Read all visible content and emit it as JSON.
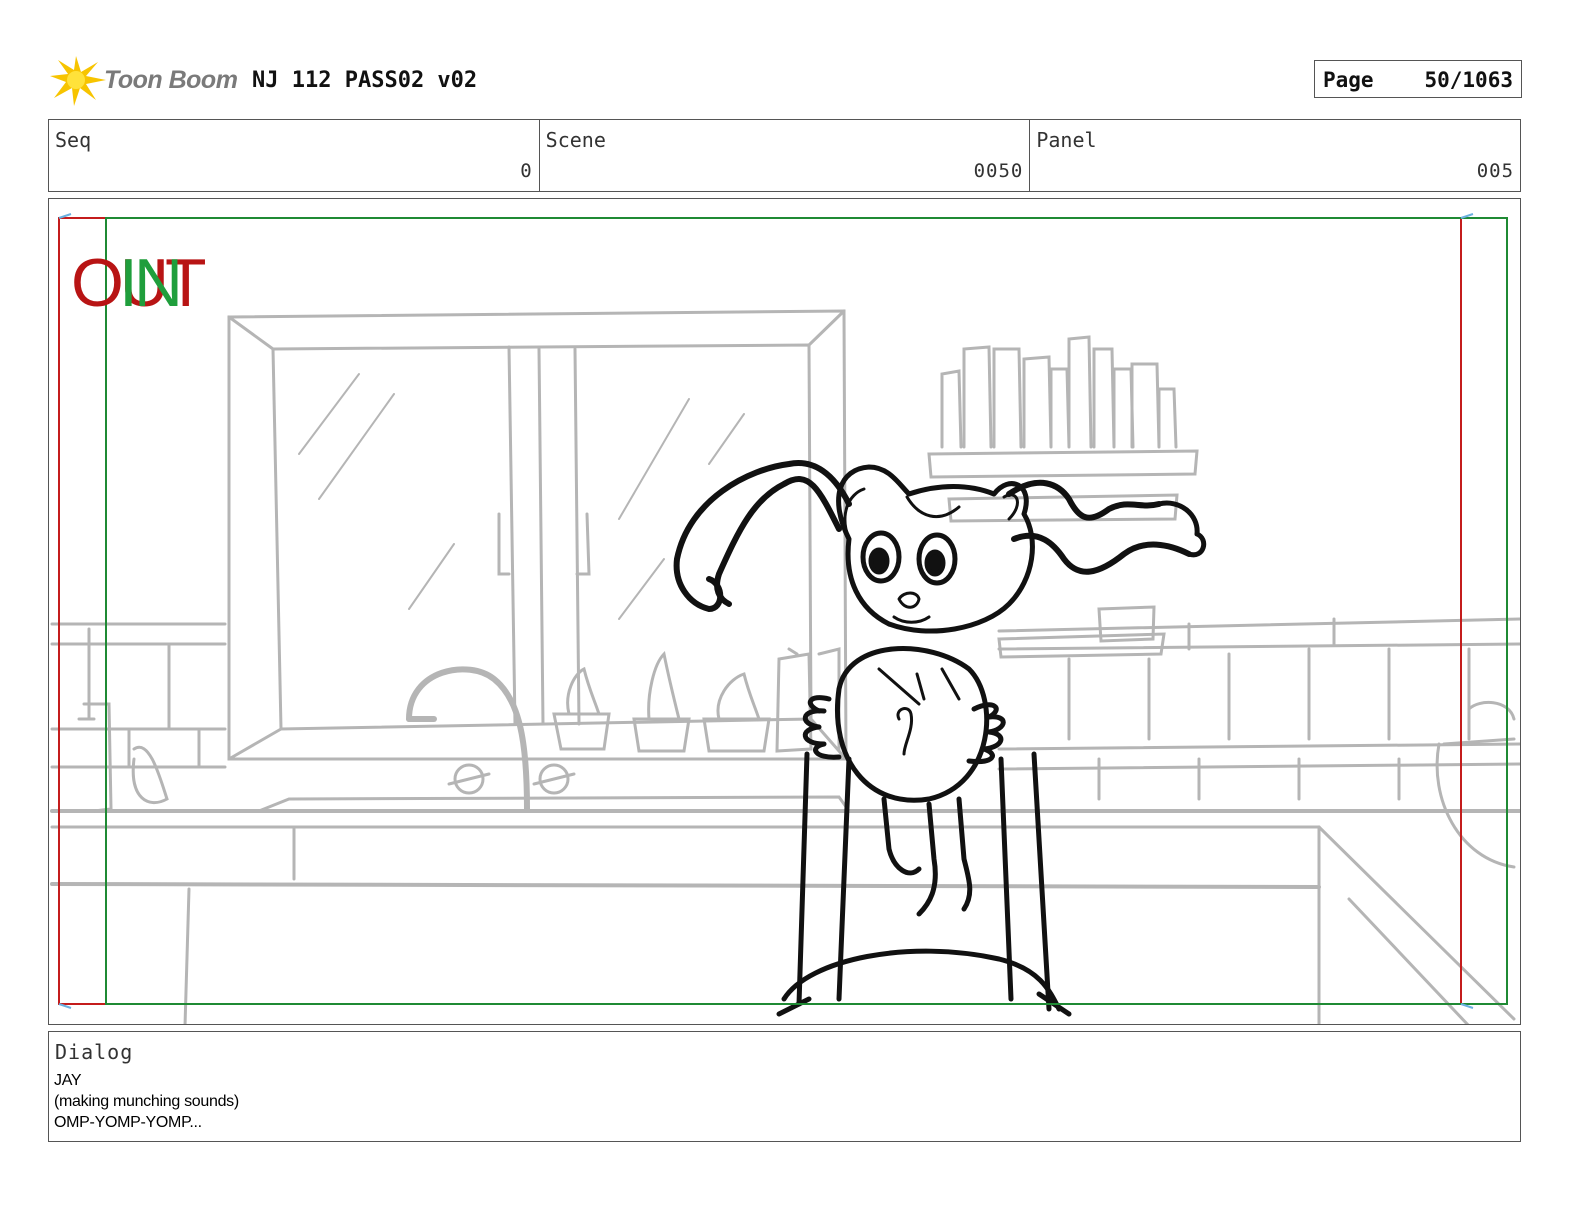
{
  "header": {
    "logo_text": "Toon Boom",
    "title": "NJ 112 PASS02 v02",
    "page_label": "Page",
    "page_value": "50/1063"
  },
  "info": {
    "seq_label": "Seq",
    "seq_value": "0",
    "scene_label": "Scene",
    "scene_value": "0050",
    "panel_label": "Panel",
    "panel_value": "005"
  },
  "panel": {
    "in_marker": "IN",
    "out_marker": "OUT",
    "in_color": "#1f9e3c",
    "out_color": "#b81414"
  },
  "dialog": {
    "label": "Dialog",
    "lines": [
      "JAY",
      "(making munching sounds)",
      "OMP-YOMP-YOMP..."
    ]
  }
}
